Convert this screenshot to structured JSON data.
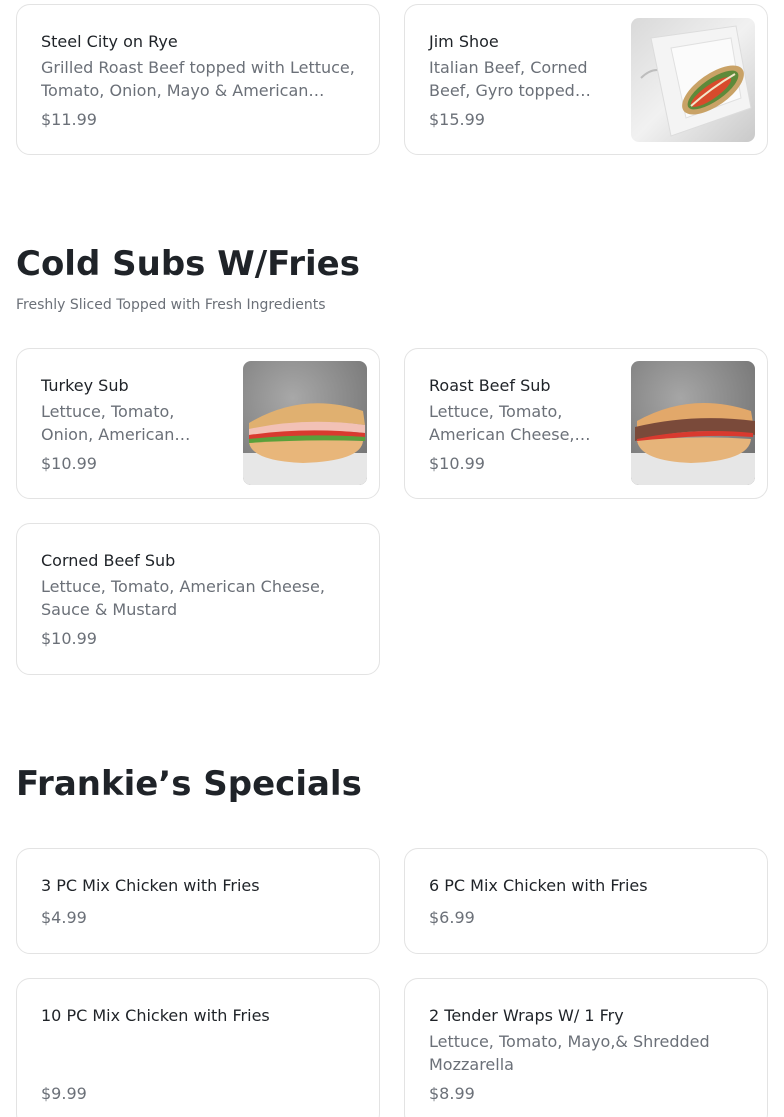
{
  "top_items": [
    {
      "name": "Steel City on Rye",
      "description": "Grilled Roast Beef topped with Lettuce, Tomato, Onion, Mayo & American Cheese",
      "price": "$11.99"
    },
    {
      "name": "Jim Shoe",
      "description": "Italian Beef, Corned Beef, Gyro topped with Lettuce, Tomato",
      "price": "$15.99",
      "image": "sandwich-in-foam-container"
    }
  ],
  "sections": [
    {
      "title": "Cold Subs W/Fries",
      "subtitle": "Freshly Sliced Topped with Fresh Ingredients",
      "items": [
        {
          "name": "Turkey Sub",
          "description": "Lettuce, Tomato, Onion, American Cheese",
          "price": "$10.99",
          "image": "turkey-sub"
        },
        {
          "name": "Roast Beef Sub",
          "description": "Lettuce, Tomato, American Cheese, Onion",
          "price": "$10.99",
          "image": "roast-beef-sub"
        },
        {
          "name": "Corned Beef Sub",
          "description": "Lettuce, Tomato, American Cheese, Sauce & Mustard",
          "price": "$10.99"
        }
      ]
    },
    {
      "title": "Frankie’s Specials",
      "items": [
        {
          "name": "3 PC Mix Chicken with Fries",
          "price": "$4.99"
        },
        {
          "name": "6 PC Mix Chicken with Fries",
          "price": "$6.99"
        },
        {
          "name": "10 PC Mix Chicken with Fries",
          "price": "$9.99"
        },
        {
          "name": "2 Tender Wraps W/ 1 Fry",
          "description": "Lettuce, Tomato, Mayo,& Shredded Mozzarella",
          "price": "$8.99"
        }
      ]
    }
  ],
  "colors": {
    "text": "#1f2328",
    "muted": "#6b7078",
    "border": "#e3e3e3"
  }
}
